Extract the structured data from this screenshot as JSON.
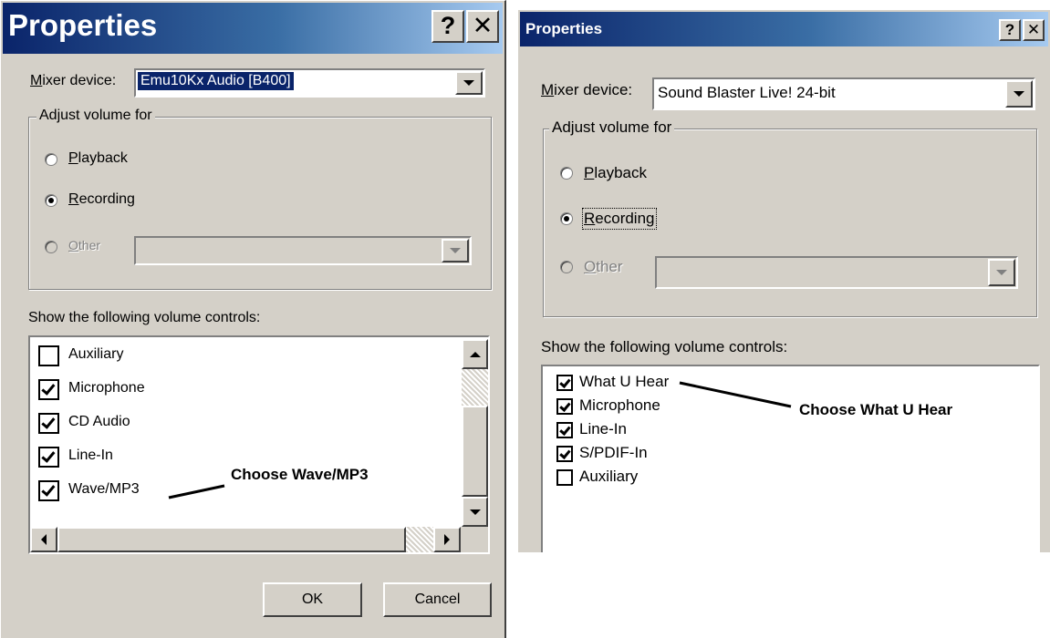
{
  "left_dialog": {
    "title": "Properties",
    "help_glyph": "?",
    "close_glyph": "✕",
    "mixer_label": "Mixer device:",
    "mixer_label_mnemonic": "M",
    "mixer_label_rest": "ixer device:",
    "mixer_value": "Emu10Kx Audio [B400]",
    "group_legend": "Adjust volume for",
    "radio_playback": {
      "mn": "P",
      "rest": "layback",
      "checked": false
    },
    "radio_recording": {
      "mn": "R",
      "rest": "ecording",
      "checked": true
    },
    "radio_other": {
      "mn": "O",
      "rest": "ther",
      "checked": false,
      "disabled": true
    },
    "controls_label": "Show the following volume controls:",
    "items": [
      {
        "label": "Auxiliary",
        "checked": false
      },
      {
        "label": "Microphone",
        "checked": true
      },
      {
        "label": "CD Audio",
        "checked": true
      },
      {
        "label": "Line-In",
        "checked": true
      },
      {
        "label": "Wave/MP3",
        "checked": true
      }
    ],
    "ok_label": "OK",
    "cancel_label": "Cancel",
    "callout": "Choose Wave/MP3"
  },
  "right_dialog": {
    "title": "Properties",
    "help_glyph": "?",
    "close_glyph": "✕",
    "mixer_label_mnemonic": "M",
    "mixer_label_rest": "ixer device:",
    "mixer_value": "Sound Blaster Live! 24-bit",
    "group_legend": "Adjust volume for",
    "radio_playback": {
      "mn": "P",
      "rest": "layback",
      "checked": false
    },
    "radio_recording": {
      "mn": "R",
      "rest": "ecording",
      "checked": true
    },
    "radio_other": {
      "mn": "O",
      "rest": "ther",
      "checked": false,
      "disabled": true
    },
    "controls_label": "Show the following volume controls:",
    "items": [
      {
        "label": "What U Hear",
        "checked": true
      },
      {
        "label": "Microphone",
        "checked": true
      },
      {
        "label": "Line-In",
        "checked": true
      },
      {
        "label": "S/PDIF-In",
        "checked": true
      },
      {
        "label": "Auxiliary",
        "checked": false
      }
    ],
    "callout": "Choose What U Hear"
  },
  "colors": {
    "dialog_face": "#d4d0c8",
    "title_gradient_start": "#0a246a",
    "title_gradient_end": "#a6caf0",
    "selection": "#0a246a"
  }
}
